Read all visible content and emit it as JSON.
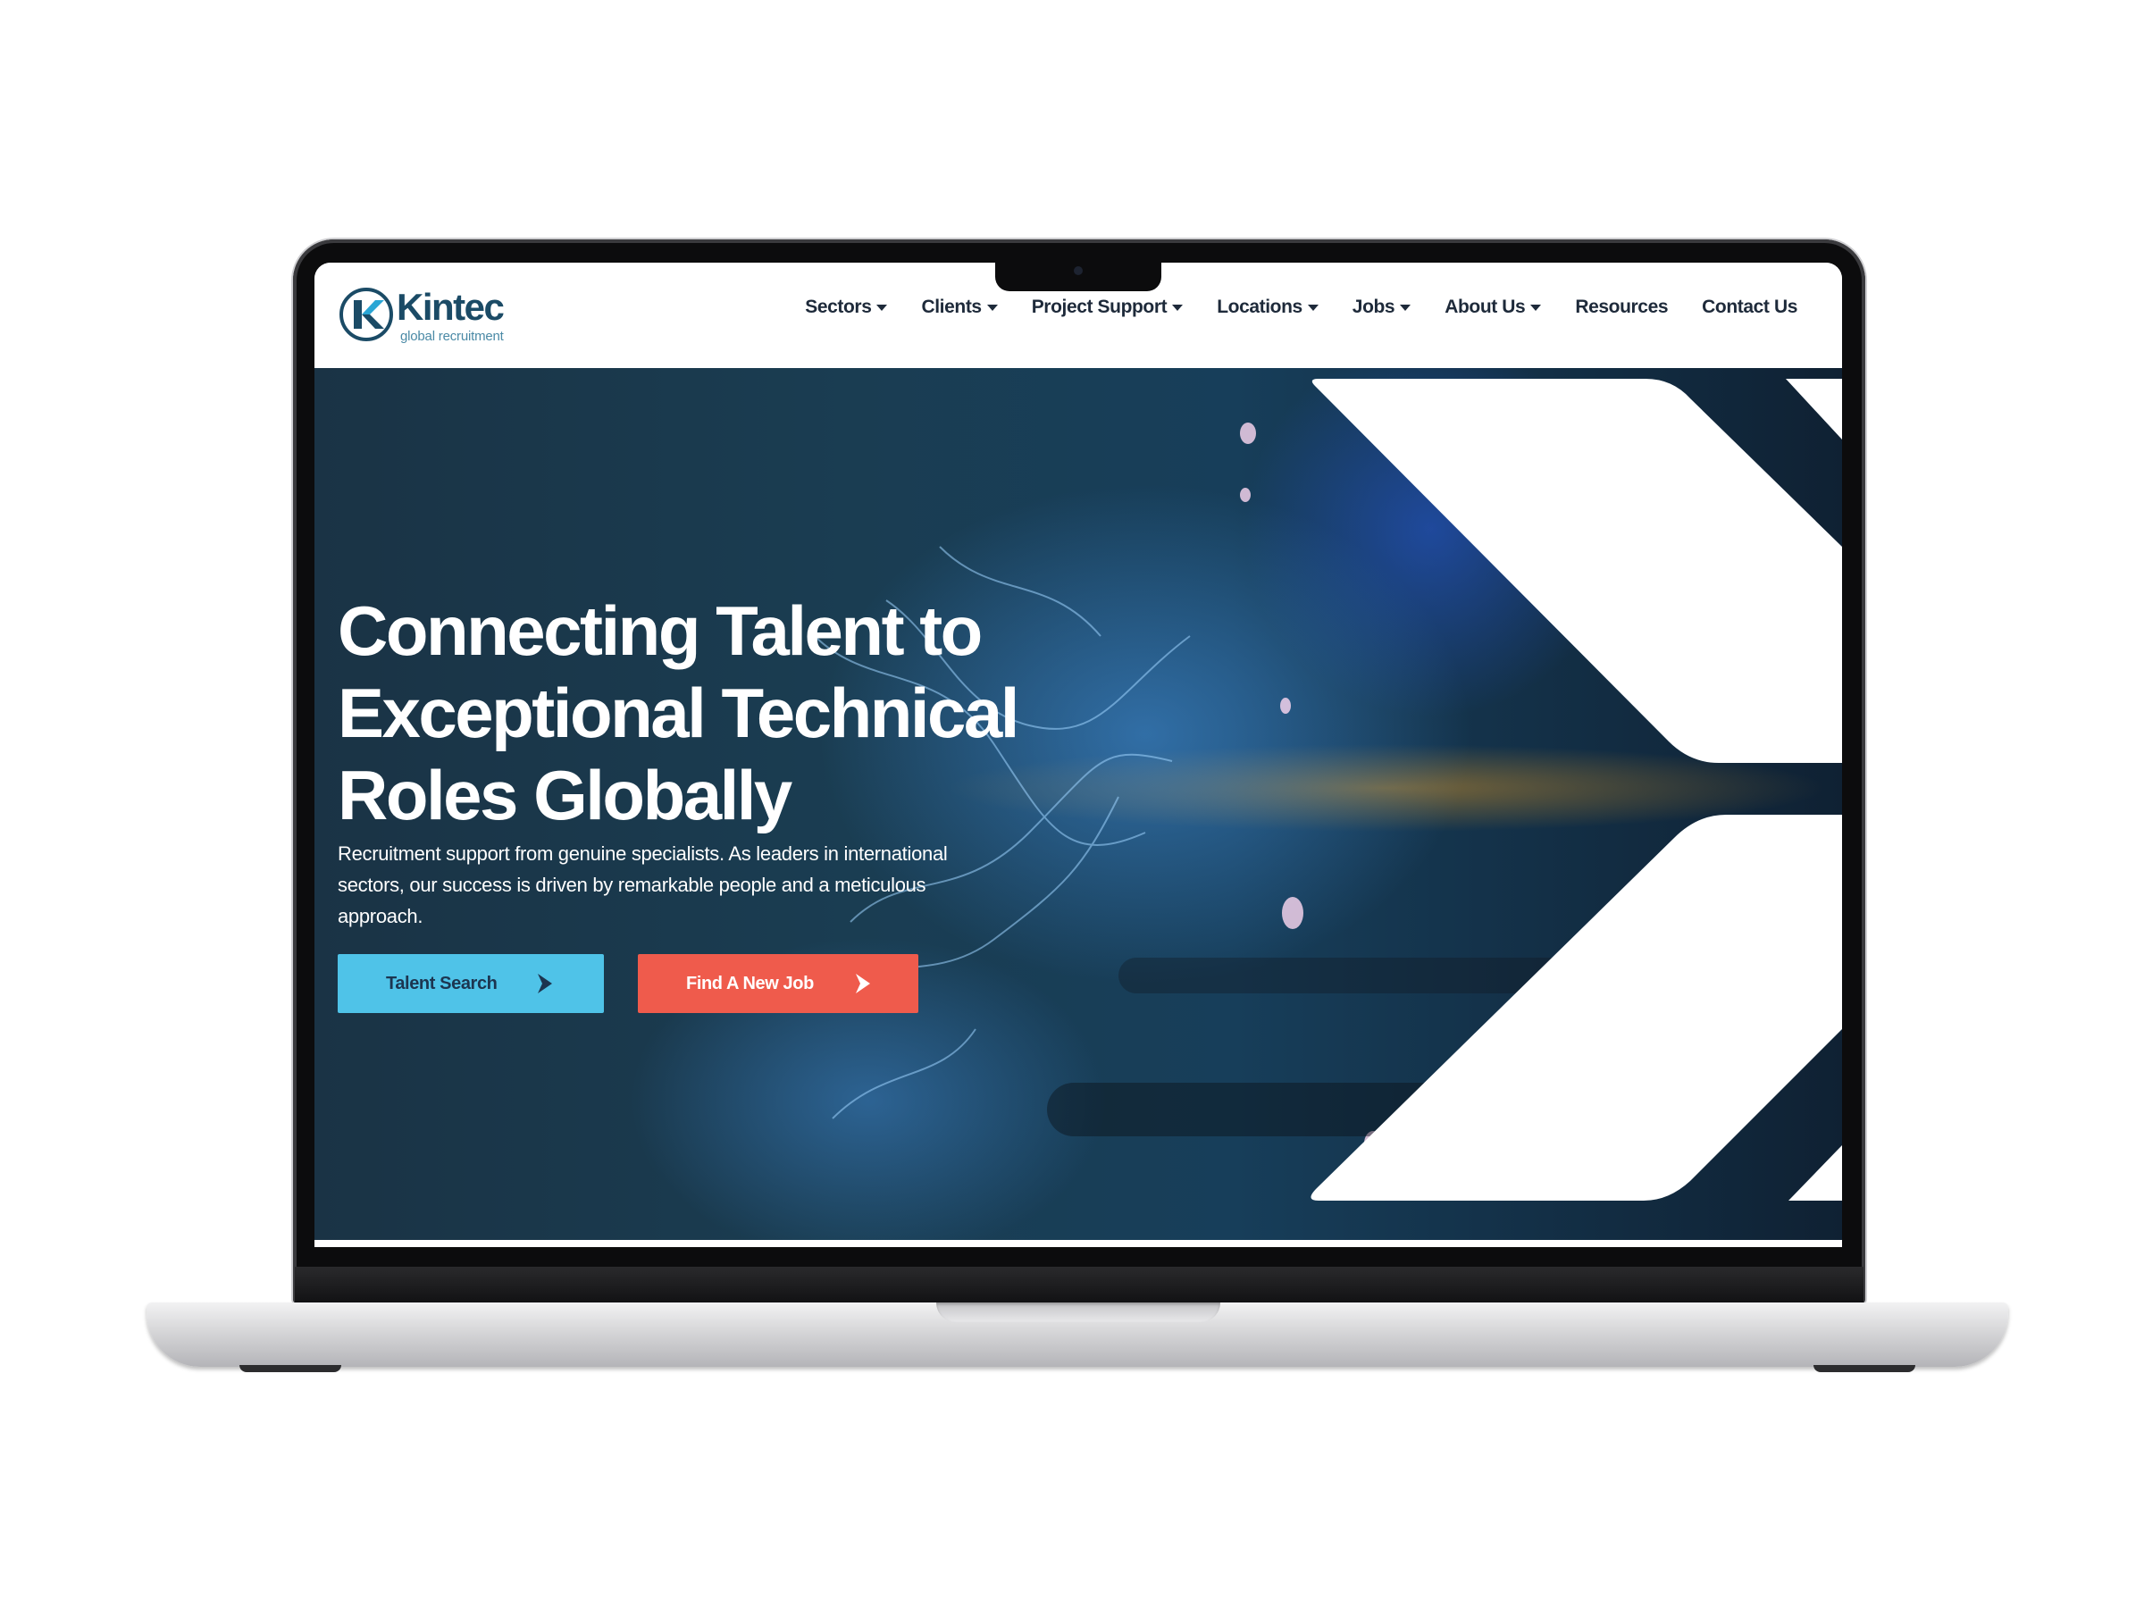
{
  "brand": {
    "name": "Kintec",
    "tagline": "global recruitment"
  },
  "nav": {
    "items": [
      {
        "label": "Sectors",
        "has_dropdown": true
      },
      {
        "label": "Clients",
        "has_dropdown": true
      },
      {
        "label": "Project Support",
        "has_dropdown": true
      },
      {
        "label": "Locations",
        "has_dropdown": true
      },
      {
        "label": "Jobs",
        "has_dropdown": true
      },
      {
        "label": "About Us",
        "has_dropdown": true
      },
      {
        "label": "Resources",
        "has_dropdown": false
      },
      {
        "label": "Contact Us",
        "has_dropdown": false
      }
    ]
  },
  "hero": {
    "heading_lines": [
      "Connecting Talent to",
      "Exceptional Technical",
      "Roles Globally"
    ],
    "subtext_lines": [
      "Recruitment support from genuine specialists. As leaders in international",
      "sectors, our success is driven by remarkable people and a meticulous",
      "approach."
    ],
    "buttons": {
      "talent_search": "Talent Search",
      "find_job": "Find A New Job"
    }
  },
  "colors": {
    "brand_navy": "#1b4b66",
    "talent_button": "#4fc3e8",
    "job_button": "#ef5b4c",
    "hero_overlay": "#1a3345"
  },
  "icons": {
    "logo": "kintec-k-logo",
    "dropdown": "caret-down-icon",
    "button_arrow": "chevron-right-icon",
    "background": "welding-sparks-photo"
  }
}
